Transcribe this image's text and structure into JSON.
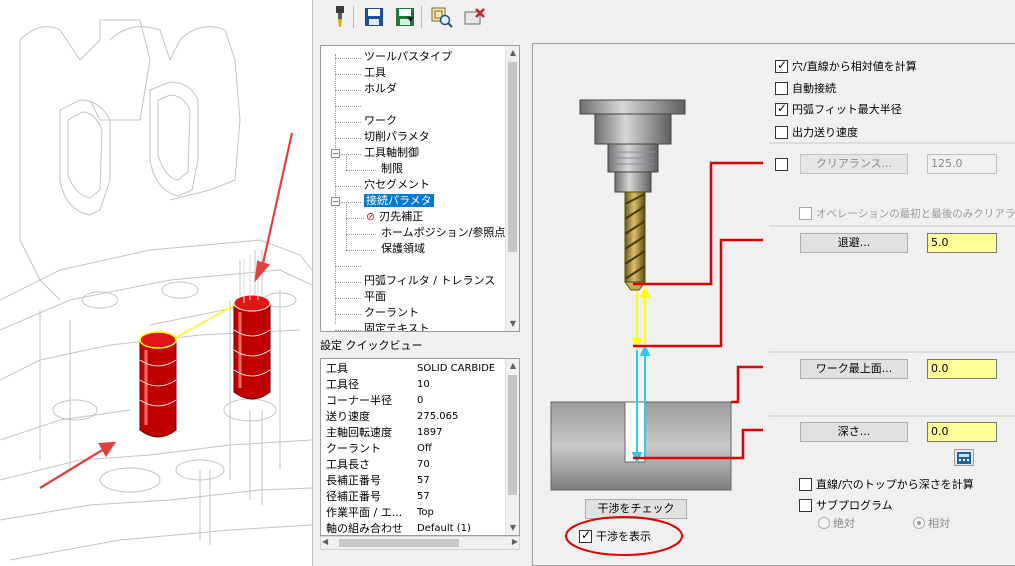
{
  "toolbar": {
    "icons": [
      "tool-icon",
      "save-icon",
      "save-as-icon",
      "preview-icon",
      "delete-icon"
    ]
  },
  "tree": {
    "items": [
      {
        "label": "ツールパスタイプ"
      },
      {
        "label": "工具"
      },
      {
        "label": "ホルダ"
      },
      {
        "label": ""
      },
      {
        "label": "ワーク"
      },
      {
        "label": "切削パラメタ"
      },
      {
        "label": "工具軸制御"
      },
      {
        "label": "制限"
      },
      {
        "label": "穴セグメント"
      },
      {
        "label": "接続パラメタ"
      },
      {
        "label": "刃先補正"
      },
      {
        "label": "ホームポジション/参照点"
      },
      {
        "label": "保護領域"
      },
      {
        "label": ""
      },
      {
        "label": "円弧フィルタ / トレランス"
      },
      {
        "label": "平面"
      },
      {
        "label": "クーラント"
      },
      {
        "label": "固定テキスト"
      }
    ],
    "selected": "接続パラメタ"
  },
  "quickview": {
    "label": "設定 クイックビュー",
    "rows": [
      {
        "key": "工具",
        "value": "SOLID CARBIDE"
      },
      {
        "key": "工具径",
        "value": "10"
      },
      {
        "key": "コーナー半径",
        "value": "0"
      },
      {
        "key": "送り速度",
        "value": "275.065"
      },
      {
        "key": "主軸回転速度",
        "value": "1897"
      },
      {
        "key": "クーラント",
        "value": "Off"
      },
      {
        "key": "工具長さ",
        "value": "70"
      },
      {
        "key": "長補正番号",
        "value": "57"
      },
      {
        "key": "径補正番号",
        "value": "57"
      },
      {
        "key": "作業平面 / エ...",
        "value": "Top"
      },
      {
        "key": "軸の組み合わせ",
        "value": "Default (1)"
      }
    ]
  },
  "options": {
    "relative_from_hole": "穴/直線から相対値を計算",
    "auto_connect": "自動接続",
    "arc_fit_max": "円弧フィット最大半径",
    "output_feed": "出力送り速度"
  },
  "clearance": {
    "button": "クリアランス...",
    "value": "125.0",
    "ops_only": "オペレーションの最初と最後のみクリアランス"
  },
  "retract": {
    "button": "退避...",
    "value": "5.0"
  },
  "top_of_stock": {
    "button": "ワーク最上面...",
    "value": "0.0"
  },
  "depth": {
    "button": "深さ...",
    "value": "0.0"
  },
  "depth_from_top": "直線/穴のトップから深さを計算",
  "subprogram": "サブプログラム",
  "radio_absolute": "絶対",
  "radio_incremental": "相対",
  "check_interference": "干渉をチェック",
  "show_interference": "干渉を表示",
  "colors": {
    "accent_red": "#e00000",
    "yellow": "#ffff00",
    "cyan": "#33c8f0",
    "selection": "#0078d7"
  }
}
